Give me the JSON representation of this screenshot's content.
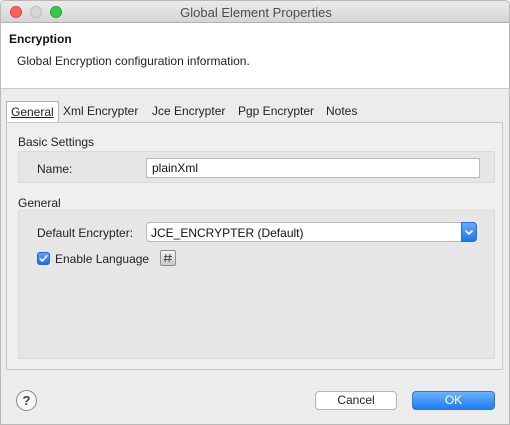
{
  "window": {
    "title": "Global Element Properties"
  },
  "header": {
    "title": "Encryption",
    "description": "Global Encryption configuration information."
  },
  "tabs": [
    {
      "label": "General",
      "active": true
    },
    {
      "label": "Xml Encrypter",
      "active": false
    },
    {
      "label": "Jce Encrypter",
      "active": false
    },
    {
      "label": "Pgp Encrypter",
      "active": false
    },
    {
      "label": "Notes",
      "active": false
    }
  ],
  "basic_settings": {
    "label": "Basic Settings",
    "name_label": "Name:",
    "name_value": "plainXml"
  },
  "general": {
    "label": "General",
    "default_encrypter_label": "Default Encrypter:",
    "default_encrypter_value": "JCE_ENCRYPTER (Default)",
    "enable_language_label": "Enable Language",
    "enable_language_checked": true
  },
  "footer": {
    "help_glyph": "?",
    "cancel_label": "Cancel",
    "ok_label": "OK"
  },
  "colors": {
    "accent": "#1f7bf0",
    "close": "#fc605c",
    "maximize": "#35c84a"
  }
}
